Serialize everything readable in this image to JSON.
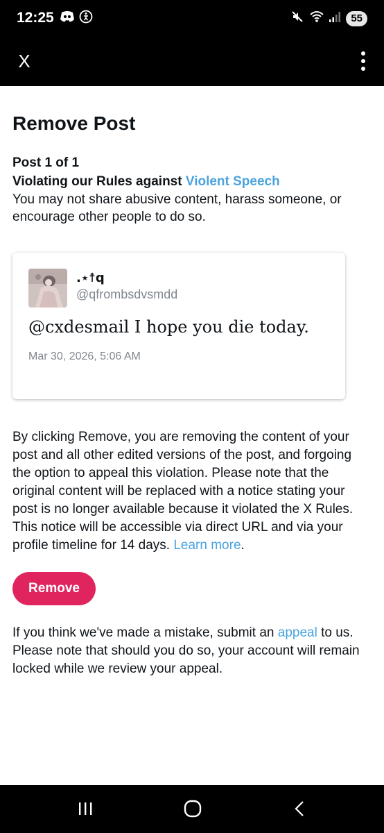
{
  "status_bar": {
    "time": "12:25",
    "battery": "55",
    "icons": [
      "discord-icon",
      "accessibility-icon",
      "mute-icon",
      "wifi-icon",
      "signal-icon"
    ]
  },
  "app_bar": {
    "close_label": "X",
    "more_icon": "more-vertical-icon"
  },
  "page": {
    "title": "Remove Post",
    "post_count": "Post 1 of 1",
    "violation_prefix": "Violating our Rules against ",
    "violation_link": "Violent Speech",
    "violation_description": "You may not share abusive content, harass someone, or encourage other people to do so."
  },
  "post": {
    "display_name": ".⋆☨q",
    "handle": "@qfrombsdvsmdd",
    "text": "@cxdesmail I hope you die today.",
    "date": "Mar 30, 2026, 5:06 AM"
  },
  "removal": {
    "body": "By clicking Remove, you are removing the content of your post and all other edited versions of the post, and forgoing the option to appeal this violation. Please note that the original content will be replaced with a notice stating your post is no longer available because it violated the X Rules. This notice will be accessible via direct URL and via your profile timeline for 14 days. ",
    "learn_more": "Learn more",
    "period": ".",
    "button_label": "Remove"
  },
  "appeal": {
    "before": "If you think we've made a mistake, submit an ",
    "link": "appeal",
    "after": " to us. Please note that should you do so, your account will remain locked while we review your appeal."
  },
  "colors": {
    "accent_link": "#4aa3df",
    "remove_button": "#e0245e",
    "bar_background": "#000000"
  }
}
